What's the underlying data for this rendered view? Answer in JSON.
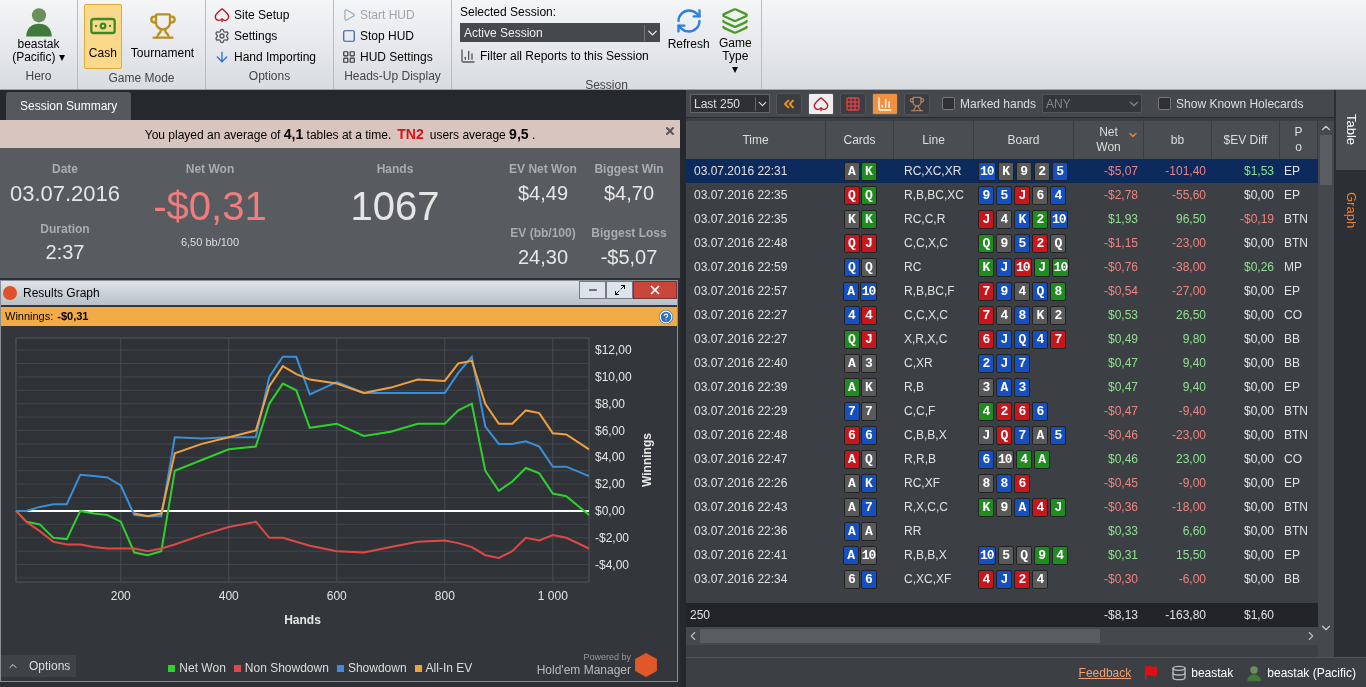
{
  "ribbon": {
    "hero": {
      "name": "beastak",
      "site": "(Pacific)",
      "caret": "▾",
      "group": "Hero"
    },
    "game_mode": {
      "group": "Game Mode",
      "items": [
        {
          "label": "Cash",
          "selected": true
        },
        {
          "label": "Tournament",
          "selected": false
        }
      ]
    },
    "options": {
      "group": "Options",
      "items": [
        {
          "label": "Site Setup",
          "disabled": false
        },
        {
          "label": "Settings",
          "disabled": false
        },
        {
          "label": "Hand Importing",
          "disabled": false
        }
      ]
    },
    "hud": {
      "group": "Heads-Up Display",
      "items": [
        {
          "label": "Start HUD",
          "disabled": true
        },
        {
          "label": "Stop HUD",
          "disabled": false
        },
        {
          "label": "HUD Settings",
          "disabled": false
        }
      ]
    },
    "session": {
      "group": "Session",
      "label": "Selected Session:",
      "value": "Active Session",
      "filter": "Filter all Reports to this Session",
      "refresh": "Refresh",
      "game_type": "Game Type",
      "caret": "▾"
    }
  },
  "summary": {
    "tab": "Session Summary",
    "banner": {
      "text1": "You played an average of **4,1** tables at a time.",
      "brand": "TN2",
      "text2": "users average **9,5** ."
    },
    "date": {
      "label": "Date",
      "value": "03.07.2016"
    },
    "duration": {
      "label": "Duration",
      "value": "2:37"
    },
    "net_won": {
      "label": "Net Won",
      "value": "-$0,31",
      "sub": "6,50 bb/100"
    },
    "hands": {
      "label": "Hands",
      "value": "1067"
    },
    "ev_net_won": {
      "label": "EV Net Won",
      "value": "$4,49"
    },
    "biggest_win": {
      "label": "Biggest Win",
      "value": "$4,70"
    },
    "ev_bb": {
      "label": "EV (bb/100)",
      "value": "24,30"
    },
    "biggest_loss": {
      "label": "Biggest Loss",
      "value": "-$5,07"
    }
  },
  "graph_window": {
    "title": "Results Graph",
    "winnings_label": "Winnings:",
    "winnings_value": "-$0,31",
    "options": "Options",
    "powered_by": "Powered by",
    "product": "Hold'em Manager",
    "chart_data": {
      "type": "line",
      "xlabel": "Hands",
      "ylabel": "Winnings",
      "x": [
        6,
        25,
        50,
        75,
        100,
        125,
        150,
        175,
        200,
        225,
        250,
        275,
        300,
        350,
        400,
        450,
        475,
        500,
        525,
        550,
        600,
        650,
        700,
        750,
        800,
        825,
        850,
        875,
        900,
        925,
        950,
        975,
        1000,
        1025,
        1067
      ],
      "series": [
        {
          "name": "Net Won",
          "color": "#2ed12e",
          "values": [
            0,
            -0.8,
            -1,
            -2,
            -2.1,
            0,
            -0.2,
            -0.3,
            -0.8,
            -3.1,
            -3.3,
            -3,
            3,
            3.8,
            4.6,
            4.8,
            8,
            9.5,
            9,
            6.2,
            6.5,
            5.6,
            5.9,
            6.5,
            6.5,
            7.5,
            8,
            3,
            1.5,
            2.2,
            3.2,
            2.8,
            1.3,
            1.1,
            -0.3
          ]
        },
        {
          "name": "Non Showdown",
          "color": "#e04848",
          "values": [
            0,
            -0.8,
            -1.5,
            -2.3,
            -2.5,
            -2.5,
            -2.7,
            -2.8,
            -2.8,
            -2.8,
            -3,
            -2.8,
            -2.5,
            -1.8,
            -1.2,
            -0.8,
            -2,
            -2,
            -2.3,
            -2.6,
            -3,
            -3.1,
            -2.7,
            -2.3,
            -2.2,
            -2.4,
            -2.7,
            -3.3,
            -3.5,
            -3,
            -2,
            -2.2,
            -1.8,
            -2,
            -2.8
          ]
        },
        {
          "name": "Showdown",
          "color": "#3a8fd8",
          "values": [
            0,
            0,
            0.3,
            0.5,
            0.5,
            2.7,
            2.6,
            2.5,
            1.9,
            -0.3,
            -0.4,
            -0.4,
            5.5,
            5.4,
            5.5,
            5.5,
            10,
            11.5,
            11.5,
            8.7,
            9.6,
            8.8,
            8.8,
            8.8,
            8.8,
            10.3,
            11.5,
            6.3,
            5,
            5,
            5.2,
            4.8,
            3.3,
            3.3,
            2.6
          ]
        },
        {
          "name": "All-In EV",
          "color": "#f0a040",
          "values": [
            null,
            null,
            null,
            null,
            null,
            null,
            null,
            null,
            null,
            -0.2,
            -0.4,
            -0.2,
            4.3,
            5,
            5.5,
            6,
            9.3,
            10.8,
            10.2,
            9.8,
            9.5,
            8.8,
            9.2,
            9.8,
            9.7,
            11,
            11.2,
            8,
            6.5,
            6.5,
            7.5,
            7.3,
            5.8,
            5.7,
            4.6
          ]
        }
      ],
      "grid": true,
      "xlim": [
        6,
        1067
      ],
      "ylim": [
        -5.3,
        12.9
      ],
      "xticks": [
        {
          "value": 200,
          "label": "200"
        },
        {
          "value": 400,
          "label": "400"
        },
        {
          "value": 600,
          "label": "600"
        },
        {
          "value": 800,
          "label": "800"
        },
        {
          "value": 1000,
          "label": "1 000"
        }
      ],
      "yticks": [
        {
          "value": 12,
          "label": "$12,00"
        },
        {
          "value": 10,
          "label": "$10,00"
        },
        {
          "value": 8,
          "label": "$8,00"
        },
        {
          "value": 6,
          "label": "$6,00"
        },
        {
          "value": 4,
          "label": "$4,00"
        },
        {
          "value": 2,
          "label": "$2,00"
        },
        {
          "value": 0,
          "label": "$0,00"
        },
        {
          "value": -2,
          "label": "-$2,00"
        },
        {
          "value": -4,
          "label": "-$4,00"
        }
      ]
    }
  },
  "hands_table": {
    "toolbar": {
      "range": "Last 250",
      "marked_label": "Marked hands",
      "marked_checked": false,
      "marked_filter": "ANY",
      "holecards_label": "Show Known Holecards",
      "holecards_checked": false
    },
    "columns": [
      {
        "label": "Time",
        "sorted": false
      },
      {
        "label": "Cards",
        "sorted": false
      },
      {
        "label": "Line",
        "sorted": false
      },
      {
        "label": "Board",
        "sorted": false
      },
      {
        "label": "Net Won",
        "sorted": true
      },
      {
        "label": "bb",
        "sorted": false
      },
      {
        "label": "$EV Diff",
        "sorted": false
      },
      {
        "label": "P o",
        "sorted": false
      }
    ],
    "rows": [
      {
        "selected": true,
        "time": "03.07.2016 22:31",
        "cards": [
          {
            "rank": "A",
            "color": "#5a5a5a"
          },
          {
            "rank": "K",
            "color": "#1e8c1e"
          }
        ],
        "line": "RC,XC,XR",
        "board": [
          {
            "rank": "10",
            "color": "#1650c0"
          },
          {
            "rank": "K",
            "color": "#5a5a5a"
          },
          {
            "rank": "9",
            "color": "#5a5a5a"
          },
          {
            "rank": "2",
            "color": "#5a5a5a"
          },
          {
            "rank": "5",
            "color": "#1650c0"
          }
        ],
        "net": {
          "text": "-$5,07",
          "color": "#f08282"
        },
        "bb": {
          "text": "-101,40",
          "color": "#f08282"
        },
        "ev": {
          "text": "$1,53",
          "color": "#8fe08f"
        },
        "pos": "EP"
      },
      {
        "selected": false,
        "time": "03.07.2016 22:35",
        "cards": [
          {
            "rank": "Q",
            "color": "#c8161c"
          },
          {
            "rank": "Q",
            "color": "#1e8c1e"
          }
        ],
        "line": "R,B,BC,XC",
        "board": [
          {
            "rank": "9",
            "color": "#1650c0"
          },
          {
            "rank": "5",
            "color": "#1650c0"
          },
          {
            "rank": "J",
            "color": "#c8161c"
          },
          {
            "rank": "6",
            "color": "#5a5a5a"
          },
          {
            "rank": "4",
            "color": "#1650c0"
          }
        ],
        "net": {
          "text": "-$2,78",
          "color": "#f08282"
        },
        "bb": {
          "text": "-55,60",
          "color": "#f08282"
        },
        "ev": {
          "text": "$0,00",
          "color": "#e4e4e4"
        },
        "pos": "EP"
      },
      {
        "selected": false,
        "time": "03.07.2016 22:35",
        "cards": [
          {
            "rank": "K",
            "color": "#5a5a5a"
          },
          {
            "rank": "K",
            "color": "#1e8c1e"
          }
        ],
        "line": "RC,C,R",
        "board": [
          {
            "rank": "J",
            "color": "#c8161c"
          },
          {
            "rank": "4",
            "color": "#5a5a5a"
          },
          {
            "rank": "K",
            "color": "#1650c0"
          },
          {
            "rank": "2",
            "color": "#1e8c1e"
          },
          {
            "rank": "10",
            "color": "#1650c0"
          }
        ],
        "net": {
          "text": "$1,93",
          "color": "#8fe08f"
        },
        "bb": {
          "text": "96,50",
          "color": "#8fe08f"
        },
        "ev": {
          "text": "-$0,19",
          "color": "#f08282"
        },
        "pos": "BTN"
      },
      {
        "selected": false,
        "time": "03.07.2016 22:48",
        "cards": [
          {
            "rank": "Q",
            "color": "#c8161c"
          },
          {
            "rank": "J",
            "color": "#c8161c"
          }
        ],
        "line": "C,C,X,C",
        "board": [
          {
            "rank": "Q",
            "color": "#1e8c1e"
          },
          {
            "rank": "9",
            "color": "#5a5a5a"
          },
          {
            "rank": "5",
            "color": "#1650c0"
          },
          {
            "rank": "2",
            "color": "#c8161c"
          },
          {
            "rank": "Q",
            "color": "#5a5a5a"
          }
        ],
        "net": {
          "text": "-$1,15",
          "color": "#f08282"
        },
        "bb": {
          "text": "-23,00",
          "color": "#f08282"
        },
        "ev": {
          "text": "$0,00",
          "color": "#e4e4e4"
        },
        "pos": "BTN"
      },
      {
        "selected": false,
        "time": "03.07.2016 22:59",
        "cards": [
          {
            "rank": "Q",
            "color": "#1650c0"
          },
          {
            "rank": "Q",
            "color": "#5a5a5a"
          }
        ],
        "line": "RC",
        "board": [
          {
            "rank": "K",
            "color": "#1e8c1e"
          },
          {
            "rank": "J",
            "color": "#1650c0"
          },
          {
            "rank": "10",
            "color": "#c8161c"
          },
          {
            "rank": "J",
            "color": "#1e8c1e"
          },
          {
            "rank": "10",
            "color": "#1e8c1e"
          }
        ],
        "net": {
          "text": "-$0,76",
          "color": "#f08282"
        },
        "bb": {
          "text": "-38,00",
          "color": "#f08282"
        },
        "ev": {
          "text": "$0,26",
          "color": "#8fe08f"
        },
        "pos": "MP"
      },
      {
        "selected": false,
        "time": "03.07.2016 22:57",
        "cards": [
          {
            "rank": "A",
            "color": "#1650c0"
          },
          {
            "rank": "10",
            "color": "#1650c0"
          }
        ],
        "line": "R,B,BC,F",
        "board": [
          {
            "rank": "7",
            "color": "#c8161c"
          },
          {
            "rank": "9",
            "color": "#1650c0"
          },
          {
            "rank": "4",
            "color": "#5a5a5a"
          },
          {
            "rank": "Q",
            "color": "#1650c0"
          },
          {
            "rank": "8",
            "color": "#1e8c1e"
          }
        ],
        "net": {
          "text": "-$0,54",
          "color": "#f08282"
        },
        "bb": {
          "text": "-27,00",
          "color": "#f08282"
        },
        "ev": {
          "text": "$0,00",
          "color": "#e4e4e4"
        },
        "pos": "EP"
      },
      {
        "selected": false,
        "time": "03.07.2016 22:27",
        "cards": [
          {
            "rank": "4",
            "color": "#1650c0"
          },
          {
            "rank": "4",
            "color": "#c8161c"
          }
        ],
        "line": "C,C,X,C",
        "board": [
          {
            "rank": "7",
            "color": "#c8161c"
          },
          {
            "rank": "4",
            "color": "#5a5a5a"
          },
          {
            "rank": "8",
            "color": "#1650c0"
          },
          {
            "rank": "K",
            "color": "#5a5a5a"
          },
          {
            "rank": "2",
            "color": "#5a5a5a"
          }
        ],
        "net": {
          "text": "$0,53",
          "color": "#8fe08f"
        },
        "bb": {
          "text": "26,50",
          "color": "#8fe08f"
        },
        "ev": {
          "text": "$0,00",
          "color": "#e4e4e4"
        },
        "pos": "CO"
      },
      {
        "selected": false,
        "time": "03.07.2016 22:27",
        "cards": [
          {
            "rank": "Q",
            "color": "#1e8c1e"
          },
          {
            "rank": "J",
            "color": "#c8161c"
          }
        ],
        "line": "X,R,X,C",
        "board": [
          {
            "rank": "6",
            "color": "#c8161c"
          },
          {
            "rank": "J",
            "color": "#1650c0"
          },
          {
            "rank": "Q",
            "color": "#1650c0"
          },
          {
            "rank": "4",
            "color": "#1650c0"
          },
          {
            "rank": "7",
            "color": "#c8161c"
          }
        ],
        "net": {
          "text": "$0,49",
          "color": "#8fe08f"
        },
        "bb": {
          "text": "9,80",
          "color": "#8fe08f"
        },
        "ev": {
          "text": "$0,00",
          "color": "#e4e4e4"
        },
        "pos": "BB"
      },
      {
        "selected": false,
        "time": "03.07.2016 22:40",
        "cards": [
          {
            "rank": "A",
            "color": "#5a5a5a"
          },
          {
            "rank": "3",
            "color": "#5a5a5a"
          }
        ],
        "line": "C,XR",
        "board": [
          {
            "rank": "2",
            "color": "#1650c0"
          },
          {
            "rank": "J",
            "color": "#1650c0"
          },
          {
            "rank": "7",
            "color": "#1650c0"
          }
        ],
        "net": {
          "text": "$0,47",
          "color": "#8fe08f"
        },
        "bb": {
          "text": "9,40",
          "color": "#8fe08f"
        },
        "ev": {
          "text": "$0,00",
          "color": "#e4e4e4"
        },
        "pos": "BB"
      },
      {
        "selected": false,
        "time": "03.07.2016 22:39",
        "cards": [
          {
            "rank": "A",
            "color": "#1e8c1e"
          },
          {
            "rank": "K",
            "color": "#5a5a5a"
          }
        ],
        "line": "R,B",
        "board": [
          {
            "rank": "3",
            "color": "#5a5a5a"
          },
          {
            "rank": "A",
            "color": "#1650c0"
          },
          {
            "rank": "3",
            "color": "#1650c0"
          }
        ],
        "net": {
          "text": "$0,47",
          "color": "#8fe08f"
        },
        "bb": {
          "text": "9,40",
          "color": "#8fe08f"
        },
        "ev": {
          "text": "$0,00",
          "color": "#e4e4e4"
        },
        "pos": "EP"
      },
      {
        "selected": false,
        "time": "03.07.2016 22:29",
        "cards": [
          {
            "rank": "7",
            "color": "#1650c0"
          },
          {
            "rank": "7",
            "color": "#5a5a5a"
          }
        ],
        "line": "C,C,F",
        "board": [
          {
            "rank": "4",
            "color": "#1e8c1e"
          },
          {
            "rank": "2",
            "color": "#c8161c"
          },
          {
            "rank": "6",
            "color": "#c8161c"
          },
          {
            "rank": "6",
            "color": "#1650c0"
          }
        ],
        "net": {
          "text": "-$0,47",
          "color": "#f08282"
        },
        "bb": {
          "text": "-9,40",
          "color": "#f08282"
        },
        "ev": {
          "text": "$0,00",
          "color": "#e4e4e4"
        },
        "pos": "BTN"
      },
      {
        "selected": false,
        "time": "03.07.2016 22:48",
        "cards": [
          {
            "rank": "6",
            "color": "#c8161c"
          },
          {
            "rank": "6",
            "color": "#1650c0"
          }
        ],
        "line": "C,B,B,X",
        "board": [
          {
            "rank": "J",
            "color": "#5a5a5a"
          },
          {
            "rank": "Q",
            "color": "#c8161c"
          },
          {
            "rank": "7",
            "color": "#1650c0"
          },
          {
            "rank": "A",
            "color": "#5a5a5a"
          },
          {
            "rank": "5",
            "color": "#1650c0"
          }
        ],
        "net": {
          "text": "-$0,46",
          "color": "#f08282"
        },
        "bb": {
          "text": "-23,00",
          "color": "#f08282"
        },
        "ev": {
          "text": "$0,00",
          "color": "#e4e4e4"
        },
        "pos": "BTN"
      },
      {
        "selected": false,
        "time": "03.07.2016 22:47",
        "cards": [
          {
            "rank": "A",
            "color": "#c8161c"
          },
          {
            "rank": "Q",
            "color": "#5a5a5a"
          }
        ],
        "line": "R,R,B",
        "board": [
          {
            "rank": "6",
            "color": "#1650c0"
          },
          {
            "rank": "10",
            "color": "#5a5a5a"
          },
          {
            "rank": "4",
            "color": "#1e8c1e"
          },
          {
            "rank": "A",
            "color": "#1e8c1e"
          }
        ],
        "net": {
          "text": "$0,46",
          "color": "#8fe08f"
        },
        "bb": {
          "text": "23,00",
          "color": "#8fe08f"
        },
        "ev": {
          "text": "$0,00",
          "color": "#e4e4e4"
        },
        "pos": "CO"
      },
      {
        "selected": false,
        "time": "03.07.2016 22:26",
        "cards": [
          {
            "rank": "A",
            "color": "#5a5a5a"
          },
          {
            "rank": "K",
            "color": "#1650c0"
          }
        ],
        "line": "RC,XF",
        "board": [
          {
            "rank": "8",
            "color": "#5a5a5a"
          },
          {
            "rank": "8",
            "color": "#1650c0"
          },
          {
            "rank": "6",
            "color": "#c8161c"
          }
        ],
        "net": {
          "text": "-$0,45",
          "color": "#f08282"
        },
        "bb": {
          "text": "-9,00",
          "color": "#f08282"
        },
        "ev": {
          "text": "$0,00",
          "color": "#e4e4e4"
        },
        "pos": "EP"
      },
      {
        "selected": false,
        "time": "03.07.2016 22:43",
        "cards": [
          {
            "rank": "A",
            "color": "#5a5a5a"
          },
          {
            "rank": "7",
            "color": "#1650c0"
          }
        ],
        "line": "R,X,C,C",
        "board": [
          {
            "rank": "K",
            "color": "#1e8c1e"
          },
          {
            "rank": "9",
            "color": "#5a5a5a"
          },
          {
            "rank": "A",
            "color": "#1650c0"
          },
          {
            "rank": "4",
            "color": "#c8161c"
          },
          {
            "rank": "J",
            "color": "#1e8c1e"
          }
        ],
        "net": {
          "text": "-$0,36",
          "color": "#f08282"
        },
        "bb": {
          "text": "-18,00",
          "color": "#f08282"
        },
        "ev": {
          "text": "$0,00",
          "color": "#e4e4e4"
        },
        "pos": "BTN"
      },
      {
        "selected": false,
        "time": "03.07.2016 22:36",
        "cards": [
          {
            "rank": "A",
            "color": "#1650c0"
          },
          {
            "rank": "A",
            "color": "#5a5a5a"
          }
        ],
        "line": "RR",
        "board": [],
        "net": {
          "text": "$0,33",
          "color": "#8fe08f"
        },
        "bb": {
          "text": "6,60",
          "color": "#8fe08f"
        },
        "ev": {
          "text": "$0,00",
          "color": "#e4e4e4"
        },
        "pos": "BTN"
      },
      {
        "selected": false,
        "time": "03.07.2016 22:41",
        "cards": [
          {
            "rank": "A",
            "color": "#1650c0"
          },
          {
            "rank": "10",
            "color": "#5a5a5a"
          }
        ],
        "line": "R,B,B,X",
        "board": [
          {
            "rank": "10",
            "color": "#1650c0"
          },
          {
            "rank": "5",
            "color": "#5a5a5a"
          },
          {
            "rank": "Q",
            "color": "#5a5a5a"
          },
          {
            "rank": "9",
            "color": "#1e8c1e"
          },
          {
            "rank": "4",
            "color": "#1e8c1e"
          }
        ],
        "net": {
          "text": "$0,31",
          "color": "#8fe08f"
        },
        "bb": {
          "text": "15,50",
          "color": "#8fe08f"
        },
        "ev": {
          "text": "$0,00",
          "color": "#e4e4e4"
        },
        "pos": "EP"
      },
      {
        "selected": false,
        "time": "03.07.2016 22:34",
        "cards": [
          {
            "rank": "6",
            "color": "#5a5a5a"
          },
          {
            "rank": "6",
            "color": "#1650c0"
          }
        ],
        "line": "C,XC,XF",
        "board": [
          {
            "rank": "4",
            "color": "#c8161c"
          },
          {
            "rank": "J",
            "color": "#1650c0"
          },
          {
            "rank": "2",
            "color": "#c8161c"
          },
          {
            "rank": "4",
            "color": "#5a5a5a"
          }
        ],
        "net": {
          "text": "-$0,30",
          "color": "#f08282"
        },
        "bb": {
          "text": "-6,00",
          "color": "#f08282"
        },
        "ev": {
          "text": "$0,00",
          "color": "#e4e4e4"
        },
        "pos": "BB"
      }
    ],
    "totals": {
      "count": "250",
      "net": "-$8,13",
      "bb": "-163,80",
      "ev": "$1,60"
    }
  },
  "side_tabs": [
    {
      "label": "Table",
      "selected": true
    },
    {
      "label": "Graph",
      "selected": false
    }
  ],
  "status_bar": {
    "feedback": "Feedback",
    "database": "beastak",
    "player": "beastak (Pacific)"
  }
}
